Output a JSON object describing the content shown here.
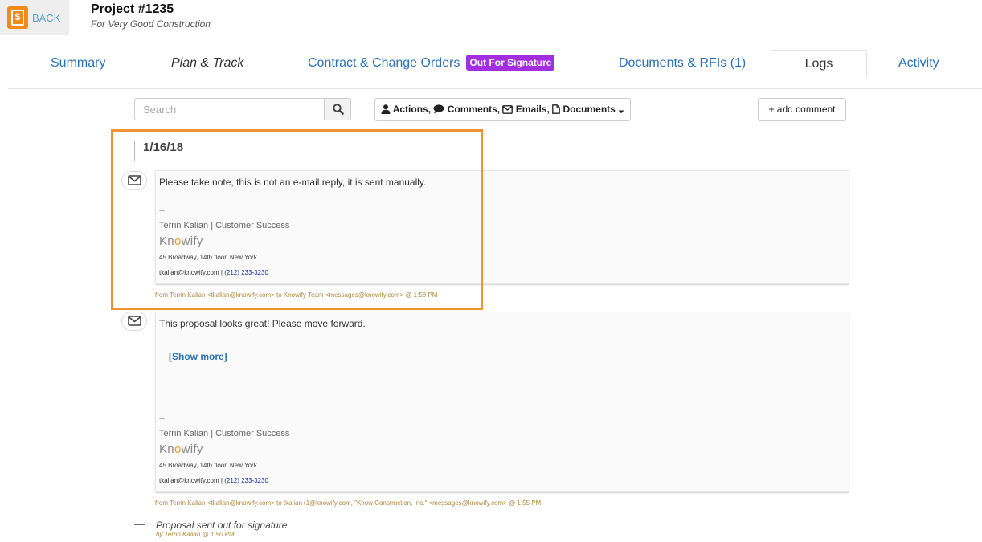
{
  "header": {
    "back_label": "BACK",
    "project_title": "Project #1235",
    "project_subtitle": "For Very Good Construction"
  },
  "tabs": [
    {
      "label": "Summary"
    },
    {
      "label": "Plan & Track"
    },
    {
      "label": "Contract & Change Orders",
      "badge": "Out For Signature"
    },
    {
      "label": "Documents & RFIs (1)"
    },
    {
      "label": "Logs",
      "active": true
    },
    {
      "label": "Activity"
    }
  ],
  "toolbar": {
    "search_placeholder": "Search",
    "filter": {
      "actions": "Actions,",
      "comments": "Comments,",
      "emails": "Emails,",
      "documents": "Documents"
    },
    "add_comment": "+ add comment"
  },
  "log": {
    "date": "1/16/18",
    "entries": [
      {
        "body": "Please take note, this is not an e-mail reply, it is sent manually.",
        "sig_dash": "--",
        "sig_name": "Terrin Kalian | Customer Success",
        "company": {
          "pre": "Kn",
          "o": "o",
          "post": "wify"
        },
        "address": "45 Broadway, 14th floor, New York",
        "email": "tkalian@knowify.com",
        "phone_sep": " | ",
        "phone": "(212) 233-3230",
        "meta": "from Terrin Kalian <tkalian@knowify.com> to Knowify Team <messages@knowify.com> @ 1:58 PM"
      },
      {
        "body": "This proposal looks great! Please move forward.",
        "show_more": "[Show more]",
        "sig_dash": "--",
        "sig_name": "Terrin Kalian | Customer Success",
        "company": {
          "pre": "Kn",
          "o": "o",
          "post": "wify"
        },
        "address": "45 Broadway, 14th floor, New York",
        "email": "tkalian@knowify.com",
        "phone_sep": " | ",
        "phone": "(212) 233-3230",
        "meta": "from Terrin Kalian <tkalian@knowify.com> to tkalian+1@knowify.com, \"Know Construction, Inc.\" <messages@knowify.com> @ 1:55 PM"
      }
    ],
    "action": {
      "dash": "—",
      "text": "Proposal sent out for signature",
      "meta": "by Terrin Kalian @ 1:50 PM"
    }
  },
  "colors": {
    "link_blue": "#2a72b5",
    "badge_purple": "#a32ee0",
    "highlight_orange": "#f09332",
    "meta_gold": "#b5863c",
    "logo_orange": "#f08a1c"
  },
  "icons": [
    "app-logo-icon",
    "search-icon",
    "user-icon",
    "comment-icon",
    "envelope-icon",
    "document-icon",
    "caret-down-icon"
  ]
}
